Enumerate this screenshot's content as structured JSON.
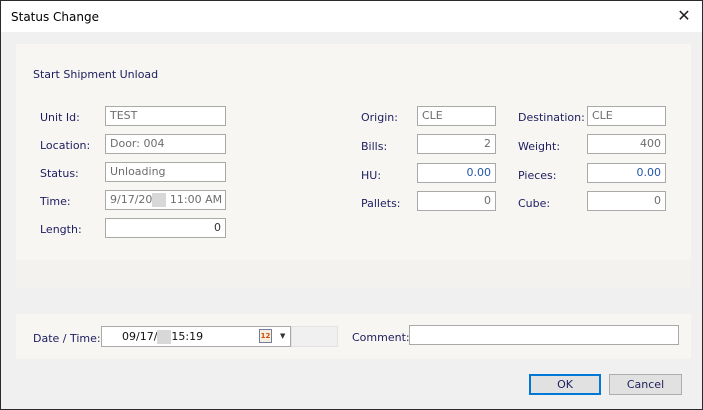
{
  "window": {
    "title": "Status Change"
  },
  "section": {
    "heading": "Start Shipment Unload"
  },
  "left": [
    {
      "label": "Unit Id:",
      "value": "TEST"
    },
    {
      "label": "Location:",
      "value": "Door: 004"
    },
    {
      "label": "Status:",
      "value": "Unloading"
    },
    {
      "label": "Time:",
      "value_prefix": "9/17/20",
      "value_suffix": "11:00 AM"
    },
    {
      "label": "Length:",
      "value": "0"
    }
  ],
  "middle": [
    {
      "label": "Origin:",
      "value": "CLE"
    },
    {
      "label": "Bills:",
      "value": "2"
    },
    {
      "label": "HU:",
      "value": "0.00"
    },
    {
      "label": "Pallets:",
      "value": "0"
    }
  ],
  "right": [
    {
      "label": "Destination:",
      "value": "CLE"
    },
    {
      "label": "Weight:",
      "value": "400"
    },
    {
      "label": "Pieces:",
      "value": "0.00"
    },
    {
      "label": "Cube:",
      "value": "0"
    }
  ],
  "footer": {
    "date_label": "Date / Time:",
    "date_prefix": "09/17/",
    "date_suffix": "15:19",
    "calendar_day": "12",
    "comment_label": "Comment:",
    "comment_value": ""
  },
  "buttons": {
    "ok": "OK",
    "cancel": "Cancel"
  }
}
